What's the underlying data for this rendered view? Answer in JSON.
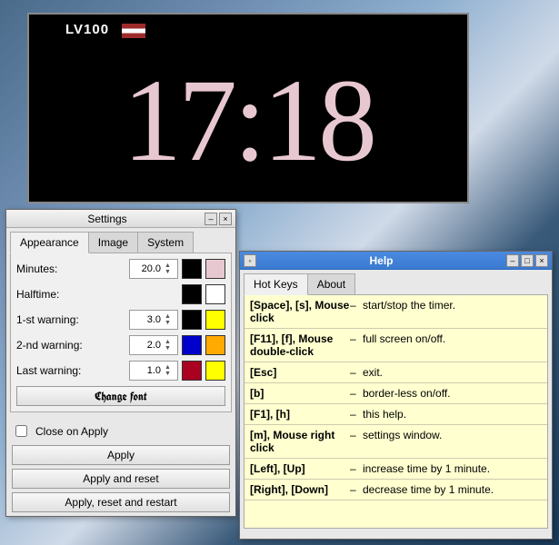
{
  "timer": {
    "logo": "LV100",
    "time": "17:18"
  },
  "settings": {
    "title": "Settings",
    "tabs": {
      "appearance": "Appearance",
      "image": "Image",
      "system": "System"
    },
    "labels": {
      "minutes": "Minutes:",
      "halftime": "Halftime:",
      "warn1": "1-st warning:",
      "warn2": "2-nd warning:",
      "lastwarn": "Last warning:"
    },
    "values": {
      "minutes": "20.0",
      "warn1": "3.0",
      "warn2": "2.0",
      "lastwarn": "1.0"
    },
    "colors": {
      "minutes_a": "#000000",
      "minutes_b": "#e8c8d0",
      "halftime_a": "#000000",
      "halftime_b": "#ffffff",
      "warn1_a": "#000000",
      "warn1_b": "#ffff00",
      "warn2_a": "#0000cc",
      "warn2_b": "#ffaa00",
      "lastwarn_a": "#aa0022",
      "lastwarn_b": "#ffff00"
    },
    "change_font": "Change font",
    "close_on_apply": "Close on Apply",
    "buttons": {
      "apply": "Apply",
      "apply_reset": "Apply and reset",
      "apply_reset_restart": "Apply, reset and restart"
    }
  },
  "help": {
    "title": "Help",
    "tabs": {
      "hotkeys": "Hot Keys",
      "about": "About"
    },
    "rows": [
      {
        "k": "[Space], [s], Mouse click",
        "d": "start/stop the timer."
      },
      {
        "k": "[F11], [f], Mouse double-click",
        "d": "full screen on/off."
      },
      {
        "k": "[Esc]",
        "d": "exit."
      },
      {
        "k": "[b]",
        "d": "border-less on/off."
      },
      {
        "k": "[F1], [h]",
        "d": "this help."
      },
      {
        "k": "[m], Mouse right click",
        "d": "settings window."
      },
      {
        "k": "[Left], [Up]",
        "d": "increase time by 1 minute."
      },
      {
        "k": "[Right], [Down]",
        "d": "decrease time by 1 minute."
      }
    ]
  }
}
